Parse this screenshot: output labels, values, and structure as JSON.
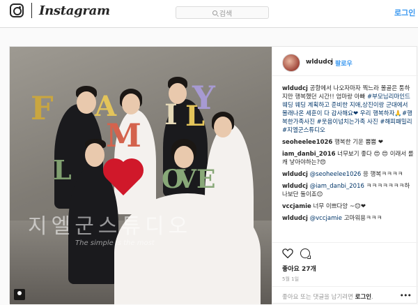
{
  "header": {
    "brand": "Instagram",
    "search_placeholder": "검색",
    "login_label": "로그인"
  },
  "photo": {
    "letters": [
      "F",
      "A",
      "M",
      "I",
      "L",
      "Y",
      "L",
      "O",
      "V",
      "E"
    ],
    "watermark": "지엘군스튜디오",
    "watermark_sub": "The simple is the most"
  },
  "post": {
    "author": "wldudcj",
    "separator": "•",
    "follow_label": "팔로우",
    "caption_text": "공항에서 나오자마자 찍느라 몰골은 퉁하지만 행복했던 시간!! 엄마랑 아빠",
    "caption_hashtags": "#부모님리마인드웨딩 웨딩 계획하고 준비한 지애,상진이랑 군대에서 몰래나온 세훈이 다 감사해요❤ 우리 행복하자🙏#행복한가족사진 #웃음이넘치는가족 사진 #해피패밀리 #지엘군스튜디오",
    "comments": [
      {
        "user": "seoheelee1026",
        "text": "행복한 기운 뿜뿜 ❤"
      },
      {
        "user": "iam_danbi_2016",
        "text": "너무보기 좋다 😍 😍 이래서 롤캐 낳아야하는?😍"
      },
      {
        "user": "wldudcj",
        "mention": "@seoheelee1026",
        "text": "응 행복ㅋㅋㅋㅋ"
      },
      {
        "user": "wldudcj",
        "mention": "@iam_danbi_2016",
        "text": "ㅋㅋㅋㅋㅋㅋㅋ하나보단 둘이죠😊"
      },
      {
        "user": "vccjamie",
        "text": "너무 이쁘다앙 ~😊❤"
      },
      {
        "user": "wldudcj",
        "mention": "@vccjamie",
        "text": "고마워용ㅋㅋㅋ"
      }
    ],
    "likes": "좋아요 27개",
    "date": "5월 1일",
    "add_comment_prefix": "좋아요 또는 댓글을 남기려면",
    "add_comment_login": "로그인",
    "add_comment_suffix": ".",
    "more": "•••"
  },
  "colors": {
    "accent": "#3897f0",
    "text": "#262626",
    "muted": "#999999",
    "border": "#dbdbdb"
  }
}
